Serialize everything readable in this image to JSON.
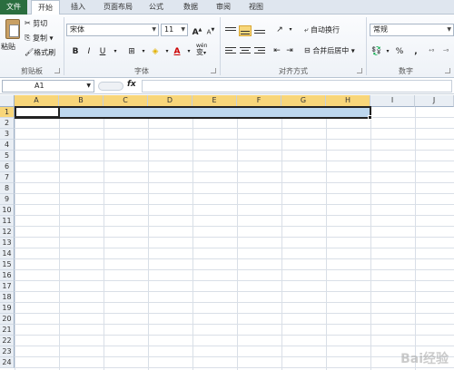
{
  "tabs": [
    {
      "label": "文件"
    },
    {
      "label": "开始"
    },
    {
      "label": "插入"
    },
    {
      "label": "页面布局"
    },
    {
      "label": "公式"
    },
    {
      "label": "数据"
    },
    {
      "label": "审阅"
    },
    {
      "label": "视图"
    }
  ],
  "clipboard": {
    "paste": "粘贴",
    "cut": "剪切",
    "copy": "复制",
    "format_painter": "格式刷",
    "group_label": "剪贴板"
  },
  "font": {
    "name": "宋体",
    "size": "11",
    "grow": "A",
    "shrink": "A",
    "bold": "B",
    "italic": "I",
    "underline": "U",
    "font_color_letter": "A",
    "wen": "wén",
    "wen_char": "变",
    "group_label": "字体"
  },
  "alignment": {
    "wrap_text": "自动换行",
    "merge_center": "合并后居中",
    "group_label": "对齐方式"
  },
  "number": {
    "format": "常规",
    "percent": "%",
    "comma": ",",
    "group_label": "数字"
  },
  "formula_bar": {
    "name_box": "A1",
    "fx": "fx",
    "value": ""
  },
  "columns": [
    "A",
    "B",
    "C",
    "D",
    "E",
    "F",
    "G",
    "H",
    "I",
    "J"
  ],
  "rows": [
    "1",
    "2",
    "3",
    "4",
    "5",
    "6",
    "7",
    "8",
    "9",
    "10",
    "11",
    "12",
    "13",
    "14",
    "15",
    "16",
    "17",
    "18",
    "19",
    "20",
    "21",
    "22",
    "23",
    "24"
  ],
  "selection": {
    "active_cell": "A1",
    "range": "A1:H1"
  },
  "colors": {
    "file_tab": "#2a6e3f",
    "selection_fill": "#bdd7ee",
    "header_highlight": "#f8d67a"
  },
  "watermark": "Bai经验"
}
